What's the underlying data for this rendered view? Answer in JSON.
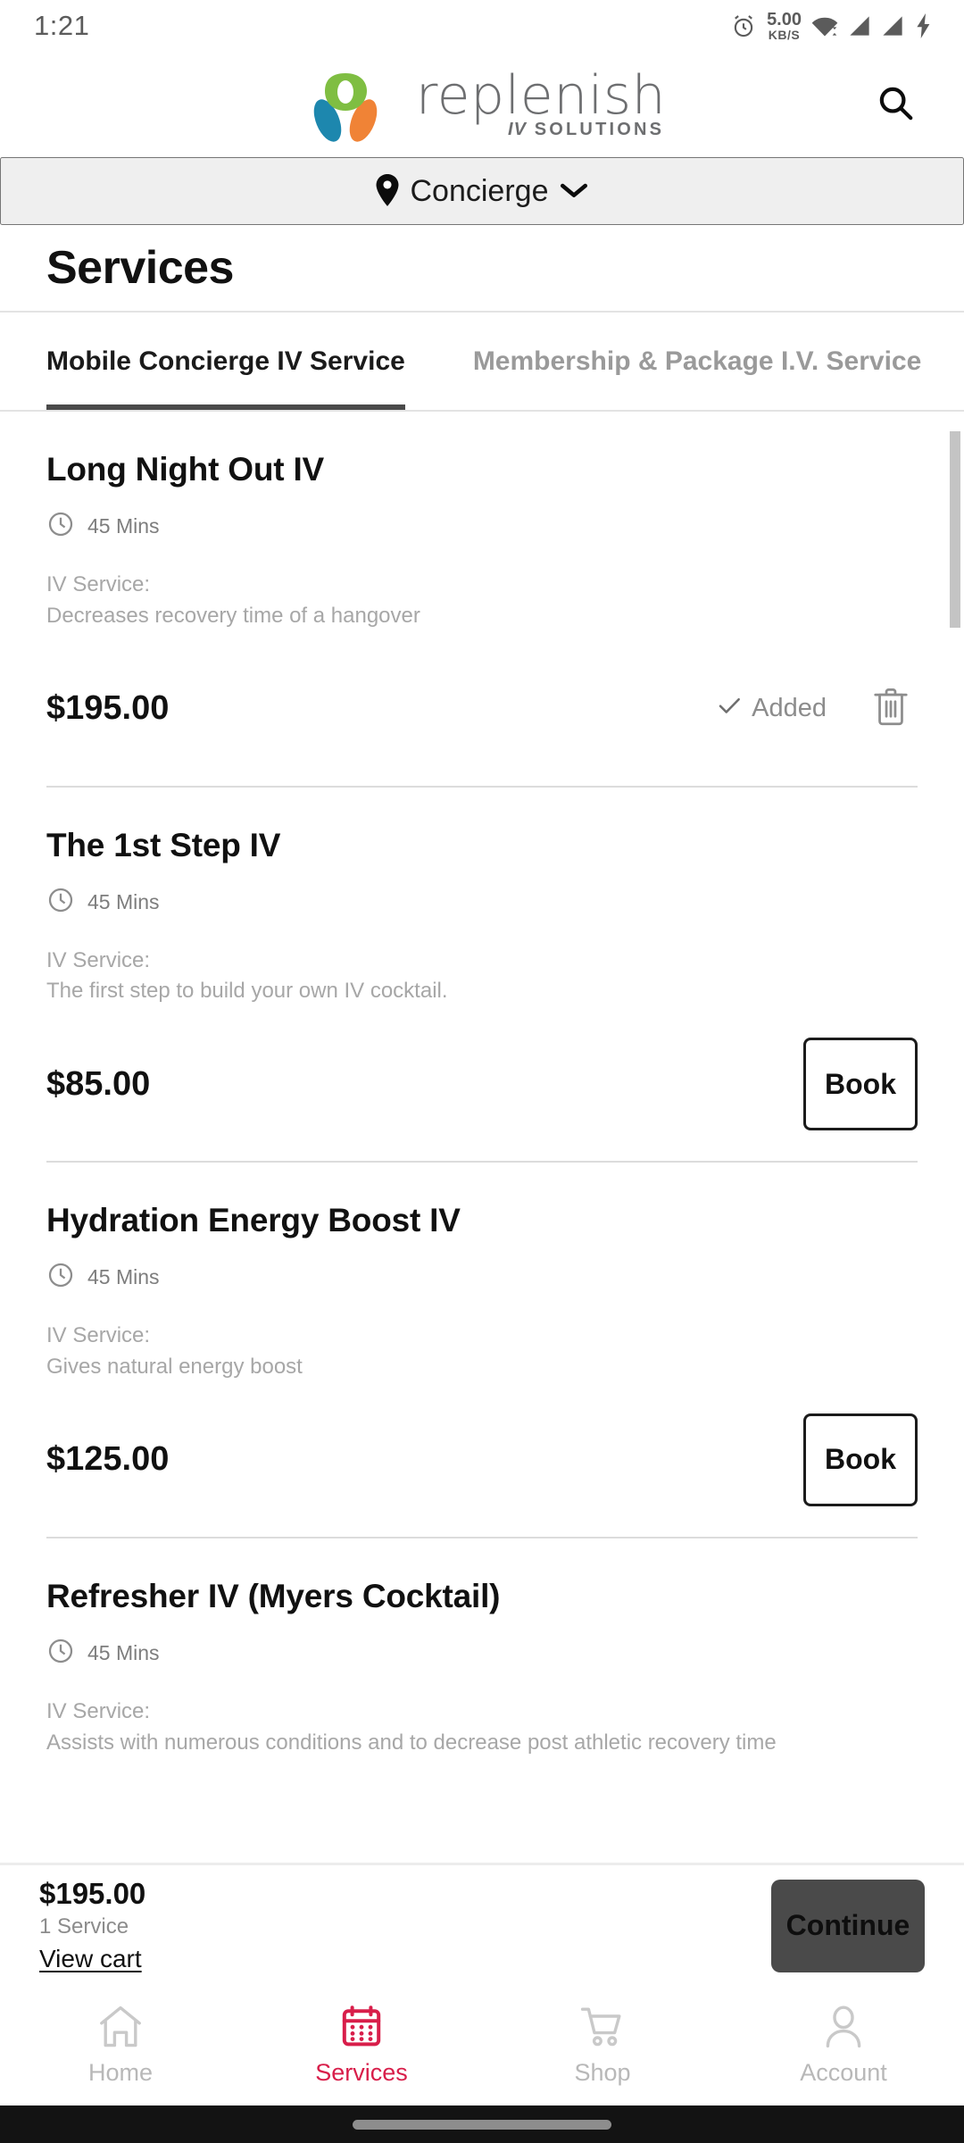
{
  "status_bar": {
    "time": "1:21",
    "net_speed_value": "5.00",
    "net_speed_unit": "KB/S",
    "icons": [
      "alarm-clock-icon",
      "wifi-icon",
      "signal-icon",
      "signal-icon",
      "charging-bolt-icon"
    ]
  },
  "header": {
    "logo_word": "replenish",
    "logo_sub_iv": "IV",
    "logo_sub_solutions": "SOLUTIONS",
    "search_icon": "search-icon",
    "logo_colors": {
      "green": "#7FBE42",
      "blue": "#1D87AE",
      "orange": "#F08336",
      "text": "#6d6e70"
    }
  },
  "location": {
    "pin_icon": "map-pin-icon",
    "label": "Concierge",
    "chevron_icon": "chevron-down-icon"
  },
  "page": {
    "title": "Services"
  },
  "tabs": [
    {
      "label": "Mobile Concierge IV Service",
      "active": true
    },
    {
      "label": "Membership & Package I.V. Service",
      "active": false
    }
  ],
  "services": [
    {
      "title": "Long Night Out IV",
      "duration": "45 Mins",
      "desc_label": "IV Service:",
      "desc_body": "Decreases recovery time of a hangover",
      "price": "$195.00",
      "state": "added",
      "added_label": "Added",
      "check_icon": "check-icon",
      "trash_icon": "trash-icon"
    },
    {
      "title": "The 1st Step IV",
      "duration": "45 Mins",
      "desc_label": "IV Service:",
      "desc_body": "The first step to build your own IV cocktail.",
      "price": "$85.00",
      "state": "book",
      "book_label": "Book"
    },
    {
      "title": "Hydration Energy Boost IV",
      "duration": "45 Mins",
      "desc_label": "IV Service:",
      "desc_body": "Gives natural energy boost",
      "price": "$125.00",
      "state": "book",
      "book_label": "Book"
    },
    {
      "title": "Refresher IV (Myers Cocktail)",
      "duration": "45 Mins",
      "desc_label": "IV Service:",
      "desc_body": "Assists with numerous conditions and to decrease post athletic recovery time",
      "price": "",
      "state": "partial"
    }
  ],
  "cart_bar": {
    "total": "$195.00",
    "count": "1 Service",
    "view_cart_label": "View cart",
    "continue_label": "Continue",
    "continue_bg": "#4a4a4a"
  },
  "bottom_nav": {
    "active_color": "#D81E4A",
    "inactive_color": "#b8b8b8",
    "items": [
      {
        "label": "Home",
        "icon": "home-icon",
        "active": false
      },
      {
        "label": "Services",
        "icon": "calendar-icon",
        "active": true
      },
      {
        "label": "Shop",
        "icon": "cart-icon",
        "active": false
      },
      {
        "label": "Account",
        "icon": "person-icon",
        "active": false
      }
    ]
  }
}
